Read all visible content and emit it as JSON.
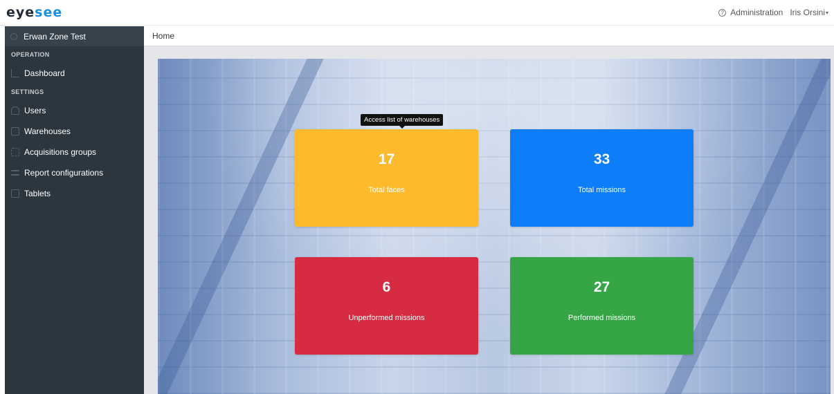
{
  "brand": {
    "logo_prefix": "eye",
    "logo_suffix": "see",
    "logo_color": "#1f2a35",
    "accent_color": "#1a8fe0"
  },
  "header": {
    "help_icon": "help-circle-icon",
    "help_glyph": "?",
    "admin_label": "Administration",
    "user_name": "Iris Orsini",
    "caret_glyph": "▾"
  },
  "sidebar": {
    "zone_name": "Erwan Zone Test",
    "sections": [
      {
        "title": "OPERATION",
        "items": [
          {
            "label": "Dashboard",
            "icon": "chart-line-icon"
          }
        ]
      },
      {
        "title": "SETTINGS",
        "items": [
          {
            "label": "Users",
            "icon": "users-icon"
          },
          {
            "label": "Warehouses",
            "icon": "building-icon"
          },
          {
            "label": "Acquisitions groups",
            "icon": "columns-icon"
          },
          {
            "label": "Report configurations",
            "icon": "report-icon"
          },
          {
            "label": "Tablets",
            "icon": "tablet-icon"
          }
        ]
      }
    ]
  },
  "breadcrumb": {
    "current": "Home"
  },
  "tooltip": {
    "text": "Access list of warehouses"
  },
  "cards": [
    {
      "value": "17",
      "label": "Total faces",
      "color": "#fdba2c"
    },
    {
      "value": "33",
      "label": "Total missions",
      "color": "#0d7ef7"
    },
    {
      "value": "6",
      "label": "Unperformed missions",
      "color": "#d62b40"
    },
    {
      "value": "27",
      "label": "Performed missions",
      "color": "#36a546"
    }
  ]
}
